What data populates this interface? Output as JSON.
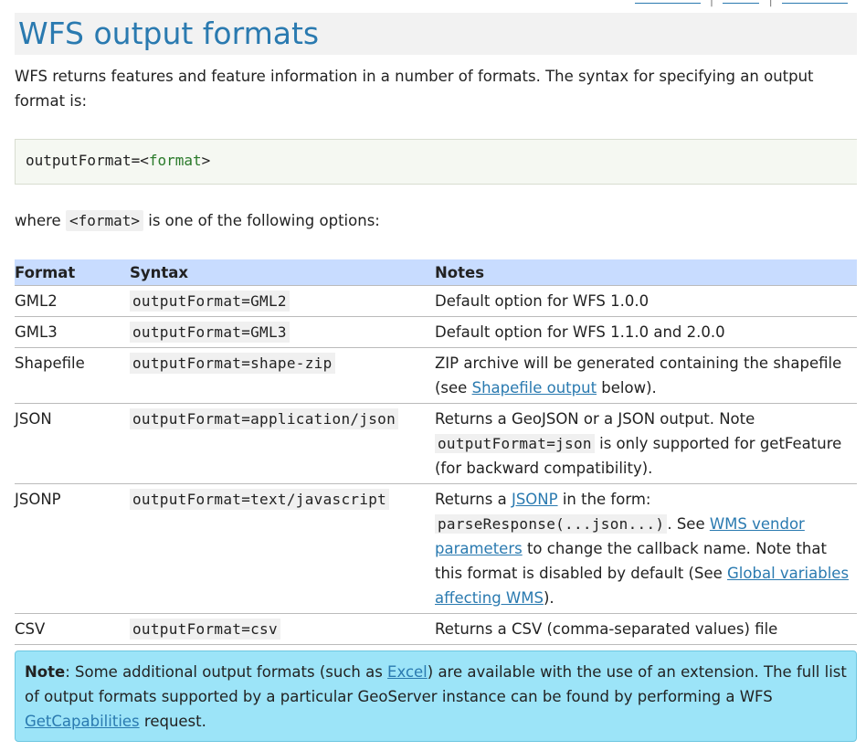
{
  "heading": "WFS output formats",
  "intro": "WFS returns features and feature information in a number of formats. The syntax for specifying an output format is:",
  "code_block": {
    "prefix": "outputFormat=",
    "lt": "<",
    "format": "format",
    "gt": ">"
  },
  "where_text": {
    "before": "where",
    "code": "<format>",
    "after": "is one of the following options:"
  },
  "table": {
    "headers": {
      "format": "Format",
      "syntax": "Syntax",
      "notes": "Notes"
    },
    "rows": [
      {
        "format": "GML2",
        "syntax": "outputFormat=GML2",
        "notes": "Default option for WFS 1.0.0"
      },
      {
        "format": "GML3",
        "syntax": "outputFormat=GML3",
        "notes": "Default option for WFS 1.1.0 and 2.0.0"
      },
      {
        "format": "Shapefile",
        "syntax": "outputFormat=shape-zip",
        "notes_a": "ZIP archive will be generated containing the shapefile (see ",
        "link": "Shapefile output",
        "notes_b": " below)."
      },
      {
        "format": "JSON",
        "syntax": "outputFormat=application/json",
        "notes_a": "Returns a GeoJSON or a JSON output. Note ",
        "code": "outputFormat=json",
        "notes_b": " is only supported for getFeature (for backward compatibility)."
      },
      {
        "format": "JSONP",
        "syntax": "outputFormat=text/javascript",
        "notes_a": "Returns a ",
        "link1": "JSONP",
        "notes_b": " in the form: ",
        "code": "parseResponse(...json...)",
        "notes_c": ". See ",
        "link2": "WMS vendor parameters",
        "notes_d": " to change the callback name. Note that this format is disabled by default (See ",
        "link3": "Global variables affecting WMS",
        "notes_e": ")."
      },
      {
        "format": "CSV",
        "syntax": "outputFormat=csv",
        "notes": "Returns a CSV (comma-separated values) file"
      }
    ]
  },
  "note": {
    "label": "Note",
    "text_a": ":   Some additional output formats (such as ",
    "link1": "Excel",
    "text_b": ") are available with the use of an extension. The full list of output formats supported by a particular GeoServer instance can be found by performing a WFS ",
    "link2": "GetCapabilities",
    "text_c": " request."
  }
}
